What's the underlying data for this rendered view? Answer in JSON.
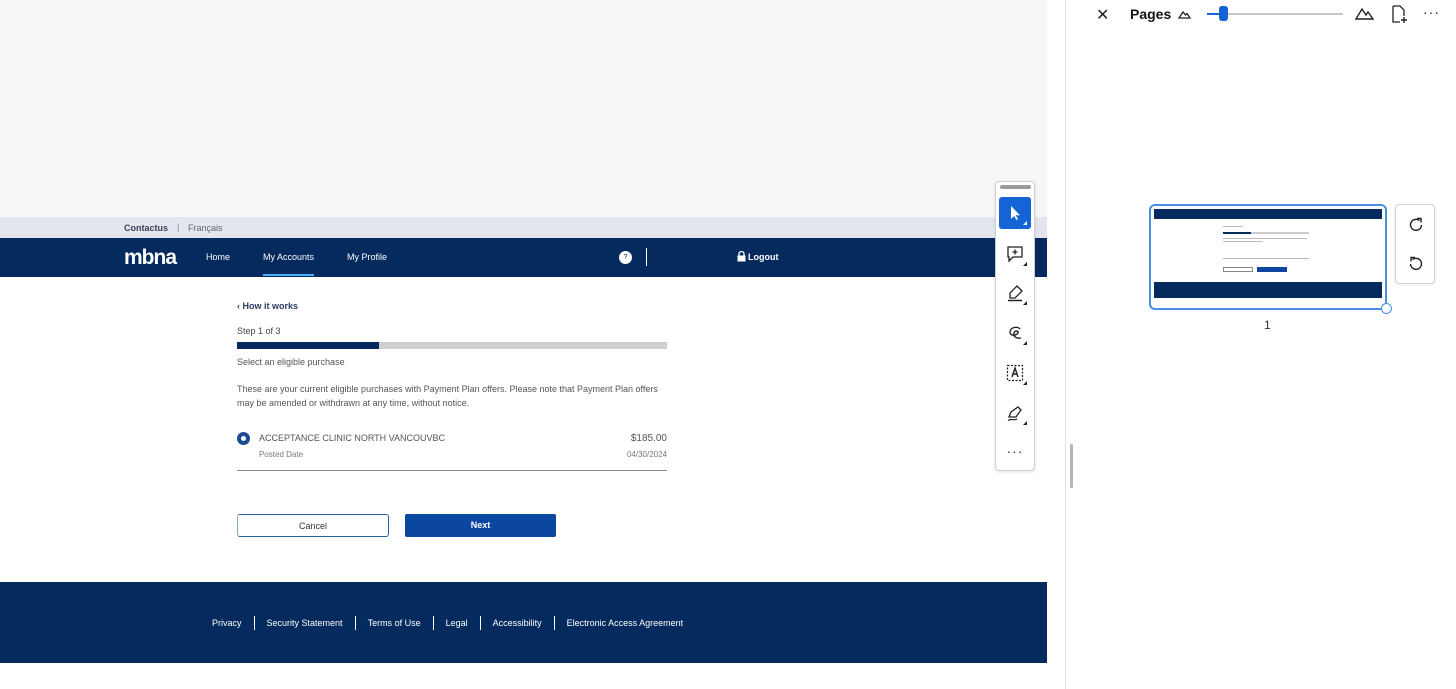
{
  "utility_bar": {
    "contact": "Contactus",
    "separator": "|",
    "language": "Français"
  },
  "navbar": {
    "logo": "mbna",
    "items": [
      "Home",
      "My Accounts",
      "My Profile"
    ],
    "help": "?",
    "logout": "Logout"
  },
  "content": {
    "back_link": "‹  How it works",
    "step": "Step 1 of 3",
    "progress_fraction": 0.33,
    "sub_label": "Select an eligible purchase",
    "description": "These are your current eligible purchases with Payment Plan offers. Please note that Payment Plan offers may be amended or withdrawn at any time, without notice.",
    "purchase": {
      "merchant": "ACCEPTANCE CLINIC NORTH VANCOUVBC",
      "amount": "$185.00",
      "posted_label": "Posted Date",
      "posted_date": "04/30/2024"
    },
    "cancel_label": "Cancel",
    "next_label": "Next"
  },
  "footer": {
    "links": [
      "Privacy",
      "Security Statement",
      "Terms of Use",
      "Legal",
      "Accessibility",
      "Electronic Access Agreement"
    ]
  },
  "toolbar": {
    "tools": [
      "select-tool-icon",
      "add-comment-icon",
      "highlight-icon",
      "draw-icon",
      "text-box-icon",
      "sign-icon"
    ],
    "more": "···"
  },
  "pages_panel": {
    "close": "✕",
    "title": "Pages",
    "zoom_fraction": 0.12,
    "more": "···",
    "page_number": "1"
  },
  "colors": {
    "brand_navy": "#042a5e",
    "accent_blue": "#1464d6",
    "button_blue": "#0b47a0"
  }
}
